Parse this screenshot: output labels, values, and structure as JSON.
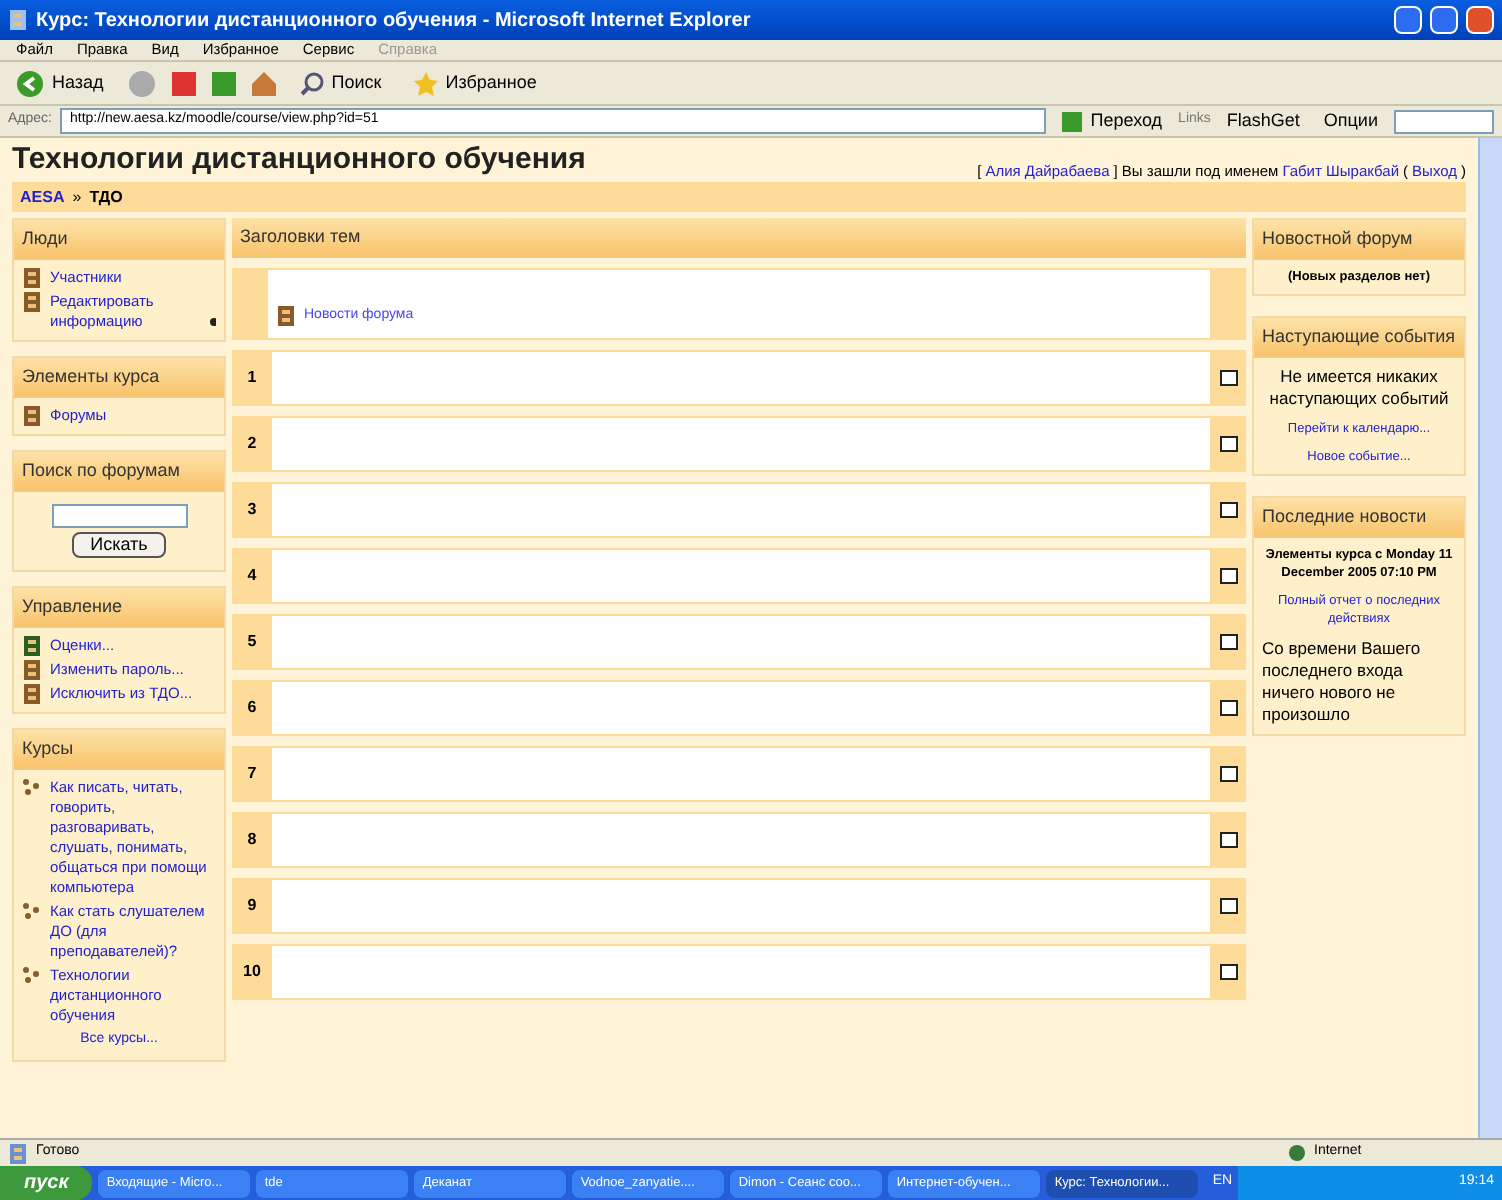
{
  "window": {
    "title": "Курс: Технологии дистанционного обучения - Microsoft Internet Explorer"
  },
  "menu": [
    {
      "label": "Файл",
      "disabled": false
    },
    {
      "label": "Правка",
      "disabled": false
    },
    {
      "label": "Вид",
      "disabled": false
    },
    {
      "label": "Избранное",
      "disabled": false
    },
    {
      "label": "Сервис",
      "disabled": false
    },
    {
      "label": "Справка",
      "disabled": true
    }
  ],
  "toolbar": {
    "back": "Назад",
    "search": "Поиск",
    "favorites": "Избранное"
  },
  "address": {
    "label": "Адрес:",
    "url": "http://new.aesa.kz/moodle/course/view.php?id=51",
    "go": "Переход",
    "links": "Links",
    "flashget": "FlashGet",
    "options": "Опции"
  },
  "page": {
    "title": "Технологии дистанционного обучения",
    "login": [
      {
        "kind": "text",
        "text": "["
      },
      {
        "kind": "link",
        "text": "Алия Дайрабаева"
      },
      {
        "kind": "text",
        "text": "] Вы зашли под именем"
      },
      {
        "kind": "link",
        "text": "Габит Шыракбай"
      },
      {
        "kind": "text",
        "text": "("
      },
      {
        "kind": "link",
        "text": "Выход"
      },
      {
        "kind": "text",
        "text": ")"
      }
    ],
    "breadcrumb": [
      {
        "label": "AESA",
        "link": true
      },
      {
        "label": "ТДО",
        "link": false
      }
    ],
    "separator": "»"
  },
  "left_blocks": [
    {
      "kind": "links",
      "title": "Люди",
      "items": [
        {
          "label": "Участники"
        },
        {
          "label": "Редактировать информацию",
          "help": true
        }
      ]
    },
    {
      "kind": "links",
      "title": "Элементы курса",
      "items": [
        {
          "label": "Форумы"
        }
      ]
    },
    {
      "kind": "search",
      "title": "Поиск по форумам",
      "button": "Искать"
    },
    {
      "kind": "links",
      "title": "Управление",
      "items": [
        {
          "label": "Оценки..."
        },
        {
          "label": "Изменить пароль..."
        },
        {
          "label": "Исключить из ТДО..."
        }
      ]
    },
    {
      "kind": "courses",
      "title": "Курсы",
      "items": [
        {
          "label": "Как писать, читать, говорить, разговаривать, слушать, понимать, общаться при помощи компьютера"
        },
        {
          "label": "Как стать слушателем ДО (для преподавателей)?"
        },
        {
          "label": "Технологии дистанционного обучения"
        }
      ],
      "more": "Все курсы..."
    }
  ],
  "topics": {
    "title": "Заголовки тем",
    "intro_link": "Новости форума",
    "sections": [
      "1",
      "2",
      "3",
      "4",
      "5",
      "6",
      "7",
      "8",
      "9",
      "10"
    ]
  },
  "right_blocks": [
    {
      "title": "Новостной форум",
      "lines": [
        {
          "kind": "bold",
          "text": "(Новых разделов нет)"
        }
      ]
    },
    {
      "title": "Наступающие события",
      "lines": [
        {
          "kind": "text",
          "text": "Не имеется никаких наступающих событий"
        },
        {
          "kind": "link",
          "text": "Перейти к календарю..."
        },
        {
          "kind": "link",
          "text": "Новое событие..."
        }
      ]
    },
    {
      "title": "Последние новости",
      "lines": [
        {
          "kind": "bold",
          "text": "Элементы курса с Monday 11 December 2005 07:10 PM"
        },
        {
          "kind": "link",
          "text": "Полный отчет о последних действиях"
        },
        {
          "kind": "plain",
          "text": "Со времени Вашего последнего входа ничего нового не произошло"
        }
      ]
    }
  ],
  "status_bar": {
    "text": "Готово",
    "zone": "Internet"
  },
  "taskbar": {
    "start": "пуск",
    "tasks": [
      {
        "label": "Входящие - Micro...",
        "selected": false
      },
      {
        "label": "tde",
        "selected": false
      },
      {
        "label": "Деканат",
        "selected": false
      },
      {
        "label": "Vodnoe_zanyatie....",
        "selected": false
      },
      {
        "label": "Dimon - Сеанс соо...",
        "selected": false
      },
      {
        "label": "Интернет-обучен...",
        "selected": false
      },
      {
        "label": "Курс: Технологии...",
        "selected": true
      }
    ],
    "lang": "EN",
    "clock": "19:14"
  }
}
